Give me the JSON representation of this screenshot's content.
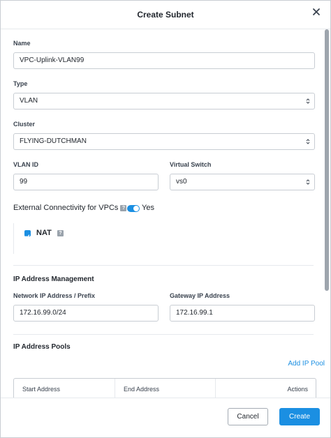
{
  "dialog": {
    "title": "Create Subnet",
    "close_icon": "close-icon",
    "cancel_label": "Cancel",
    "create_label": "Create"
  },
  "form": {
    "name": {
      "label": "Name",
      "value": "VPC-Uplink-VLAN99"
    },
    "type": {
      "label": "Type",
      "value": "VLAN"
    },
    "cluster": {
      "label": "Cluster",
      "value": "FLYING-DUTCHMAN"
    },
    "vlan_id": {
      "label": "VLAN ID",
      "value": "99"
    },
    "virtual_switch": {
      "label": "Virtual Switch",
      "value": "vs0"
    },
    "external_connectivity": {
      "label": "External Connectivity for VPCs",
      "help": "?",
      "toggle_label": "Yes",
      "enabled": true
    },
    "nat": {
      "label": "NAT",
      "help": "?",
      "checked": true
    }
  },
  "ip_management": {
    "section_title": "IP Address Management",
    "network": {
      "label": "Network IP Address / Prefix",
      "value": "172.16.99.0/24"
    },
    "gateway": {
      "label": "Gateway IP Address",
      "value": "172.16.99.1"
    }
  },
  "ip_pools": {
    "section_title": "IP Address Pools",
    "add_label": "Add IP Pool",
    "columns": [
      "Start Address",
      "End Address",
      "Actions"
    ]
  },
  "colors": {
    "accent": "#1b8fe2",
    "border": "#c8cdd3"
  }
}
